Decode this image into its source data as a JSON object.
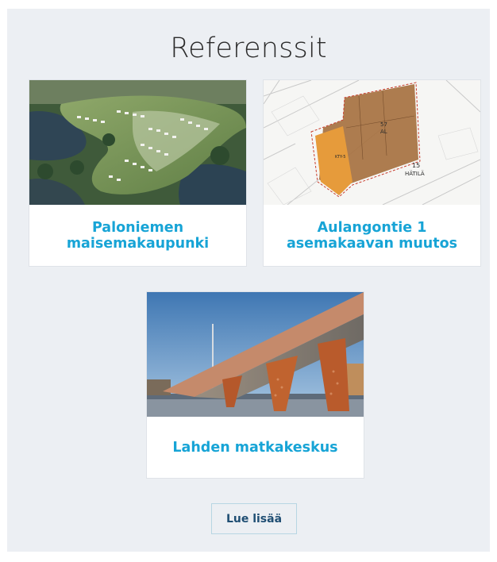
{
  "section": {
    "heading": "Referenssit"
  },
  "cards": [
    {
      "title": "Paloniemen maisemakaupunki",
      "image": "aerial-residential-area-photo"
    },
    {
      "title": "Aulangontie 1 asemakaavan muutos",
      "image": "zoning-plan-map"
    },
    {
      "title": "Lahden matkakeskus",
      "image": "travel-center-canopy-photo"
    }
  ],
  "map_labels": {
    "block": "15",
    "area": "HÄTILÄ",
    "zone": "KTY-5",
    "plot": "57",
    "plot_sub": "AL"
  },
  "read_more_label": "Lue lisää"
}
